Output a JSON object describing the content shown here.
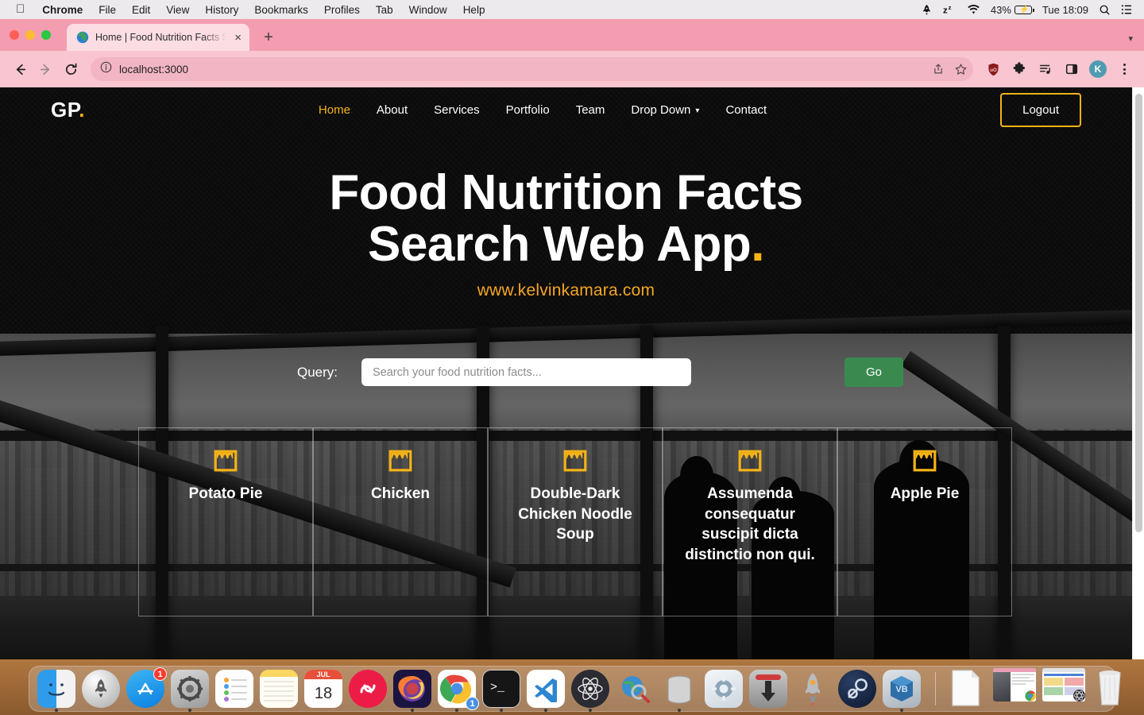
{
  "menubar": {
    "apple_icon": "apple-icon",
    "items": [
      {
        "label": "Chrome",
        "bold": true
      },
      {
        "label": "File",
        "bold": false
      },
      {
        "label": "Edit",
        "bold": false
      },
      {
        "label": "View",
        "bold": false
      },
      {
        "label": "History",
        "bold": false
      },
      {
        "label": "Bookmarks",
        "bold": false
      },
      {
        "label": "Profiles",
        "bold": false
      },
      {
        "label": "Tab",
        "bold": false
      },
      {
        "label": "Window",
        "bold": false
      },
      {
        "label": "Help",
        "bold": false
      }
    ],
    "status": {
      "battery_percent": "43%",
      "clock": "Tue 18:09",
      "icons": [
        "rocket-icon",
        "sleep-zz-icon",
        "wifi-icon",
        "battery-charging-icon",
        "search-icon",
        "control-center-icon"
      ]
    }
  },
  "browser": {
    "tab": {
      "title": "Home | Food Nutrition Facts Se",
      "favicon": "globe-favicon",
      "close_label": "×"
    },
    "new_tab_label": "+",
    "toolbar": {
      "back_icon": "back-arrow-icon",
      "forward_icon": "forward-arrow-icon",
      "reload_icon": "reload-icon",
      "site_info_icon": "info-circle-icon",
      "url": "localhost:3000",
      "share_icon": "share-icon",
      "bookmark_icon": "star-icon",
      "extensions": [
        "ublock-shield-icon",
        "puzzle-extension-icon",
        "reading-list-icon",
        "side-panel-icon"
      ],
      "profile_initial": "K",
      "menu_icon": "three-dot-menu-icon"
    },
    "scrollbar": {
      "present": true
    }
  },
  "site": {
    "logo": {
      "text": "GP",
      "dot": "."
    },
    "nav": [
      {
        "label": "Home",
        "active": true,
        "dropdown": false
      },
      {
        "label": "About",
        "active": false,
        "dropdown": false
      },
      {
        "label": "Services",
        "active": false,
        "dropdown": false
      },
      {
        "label": "Portfolio",
        "active": false,
        "dropdown": false
      },
      {
        "label": "Team",
        "active": false,
        "dropdown": false
      },
      {
        "label": "Drop Down",
        "active": false,
        "dropdown": true
      },
      {
        "label": "Contact",
        "active": false,
        "dropdown": false
      }
    ],
    "logout_label": "Logout",
    "hero": {
      "title_line1": "Food Nutrition Facts",
      "title_line2": "Search Web App",
      "title_dot": ".",
      "url": "www.kelvinkamara.com"
    },
    "search": {
      "label": "Query:",
      "placeholder": "Search your food nutrition facts...",
      "value": "",
      "button_label": "Go"
    },
    "results": [
      {
        "title": "Potato Pie",
        "icon": "storefront-icon"
      },
      {
        "title": "Chicken",
        "icon": "storefront-icon"
      },
      {
        "title": "Double-Dark Chicken Noodle Soup",
        "icon": "storefront-icon"
      },
      {
        "title": "Assumenda consequatur suscipit dicta distinctio non qui.",
        "icon": "storefront-icon"
      },
      {
        "title": "Apple Pie",
        "icon": "storefront-icon"
      }
    ],
    "colors": {
      "accent_amber": "#f5b316",
      "hero_url": "#f5a623",
      "go_button": "#3a8a50",
      "text_white": "#ffffff"
    }
  },
  "dock": {
    "apps": [
      {
        "name": "finder",
        "running": true,
        "badge": ""
      },
      {
        "name": "launchpad",
        "running": false,
        "badge": ""
      },
      {
        "name": "app-store",
        "running": false,
        "badge": "1"
      },
      {
        "name": "system-preferences",
        "running": true,
        "badge": ""
      },
      {
        "name": "reminders",
        "running": false,
        "badge": ""
      },
      {
        "name": "notes",
        "running": false,
        "badge": ""
      },
      {
        "name": "calendar",
        "running": false,
        "badge": "",
        "month": "JUL",
        "day": "18"
      },
      {
        "name": "authy",
        "running": false,
        "badge": ""
      },
      {
        "name": "firefox",
        "running": true,
        "badge": ""
      },
      {
        "name": "chrome",
        "running": true,
        "badge": "1"
      },
      {
        "name": "terminal",
        "running": true,
        "badge": ""
      },
      {
        "name": "visual-studio-code",
        "running": true,
        "badge": ""
      },
      {
        "name": "postman-electron",
        "running": true,
        "badge": ""
      },
      {
        "name": "web-inspector",
        "running": false,
        "badge": ""
      },
      {
        "name": "database",
        "running": true,
        "badge": ""
      },
      {
        "name": "settings-gear-app",
        "running": false,
        "badge": ""
      },
      {
        "name": "downloads-app",
        "running": false,
        "badge": ""
      },
      {
        "name": "rocket-app",
        "running": false,
        "badge": ""
      },
      {
        "name": "steam",
        "running": false,
        "badge": ""
      },
      {
        "name": "virtualbox",
        "running": true,
        "badge": ""
      }
    ],
    "minimized": [
      {
        "name": "document-window"
      },
      {
        "name": "chrome-window-thumbnail"
      },
      {
        "name": "browser-window-thumbnail"
      }
    ],
    "trash": {
      "name": "trash"
    }
  }
}
